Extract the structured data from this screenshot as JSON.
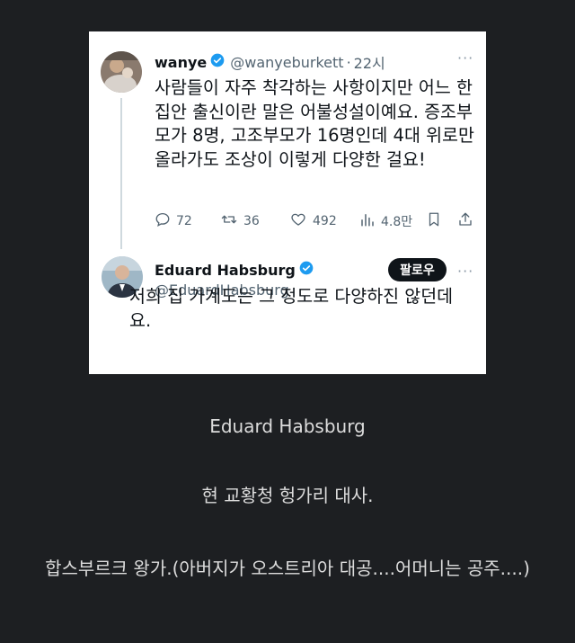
{
  "tweet1": {
    "display_name": "wanye",
    "handle": "@wanyeburkett",
    "separator": "·",
    "time": "22시",
    "text": "사람들이 자주 착각하는 사항이지만 어느 한 집안 출신이란 말은 어불성설이예요. 증조부모가 8명, 고조부모가 16명인데 4대 위로만 올라가도 조상이 이렇게 다양한 걸요!",
    "more": "···",
    "actions": {
      "replies": "72",
      "reposts": "36",
      "likes": "492",
      "views": "4.8만"
    }
  },
  "tweet2": {
    "display_name": "Eduard Habsburg",
    "handle": "@EduardHabsburg",
    "follow_label": "팔로우",
    "more": "···",
    "text": "저희 집 가계도는 그 정도로 다양하진 않던데요."
  },
  "captions": {
    "line1": "Eduard Habsburg",
    "line2": "현 교황청 헝가리 대사.",
    "line3": "합스부르크 왕가.(아버지가 오스트리아 대공....어머니는 공주....)"
  },
  "colors": {
    "page_bg": "#1d1f22",
    "card_bg": "#ffffff",
    "verified": "#1d9bf0",
    "muted_text": "#536471",
    "follow_bg": "#0f1419"
  },
  "icons": [
    "reply-icon",
    "repost-icon",
    "like-icon",
    "views-icon",
    "bookmark-icon",
    "share-icon",
    "verified-badge-icon"
  ]
}
